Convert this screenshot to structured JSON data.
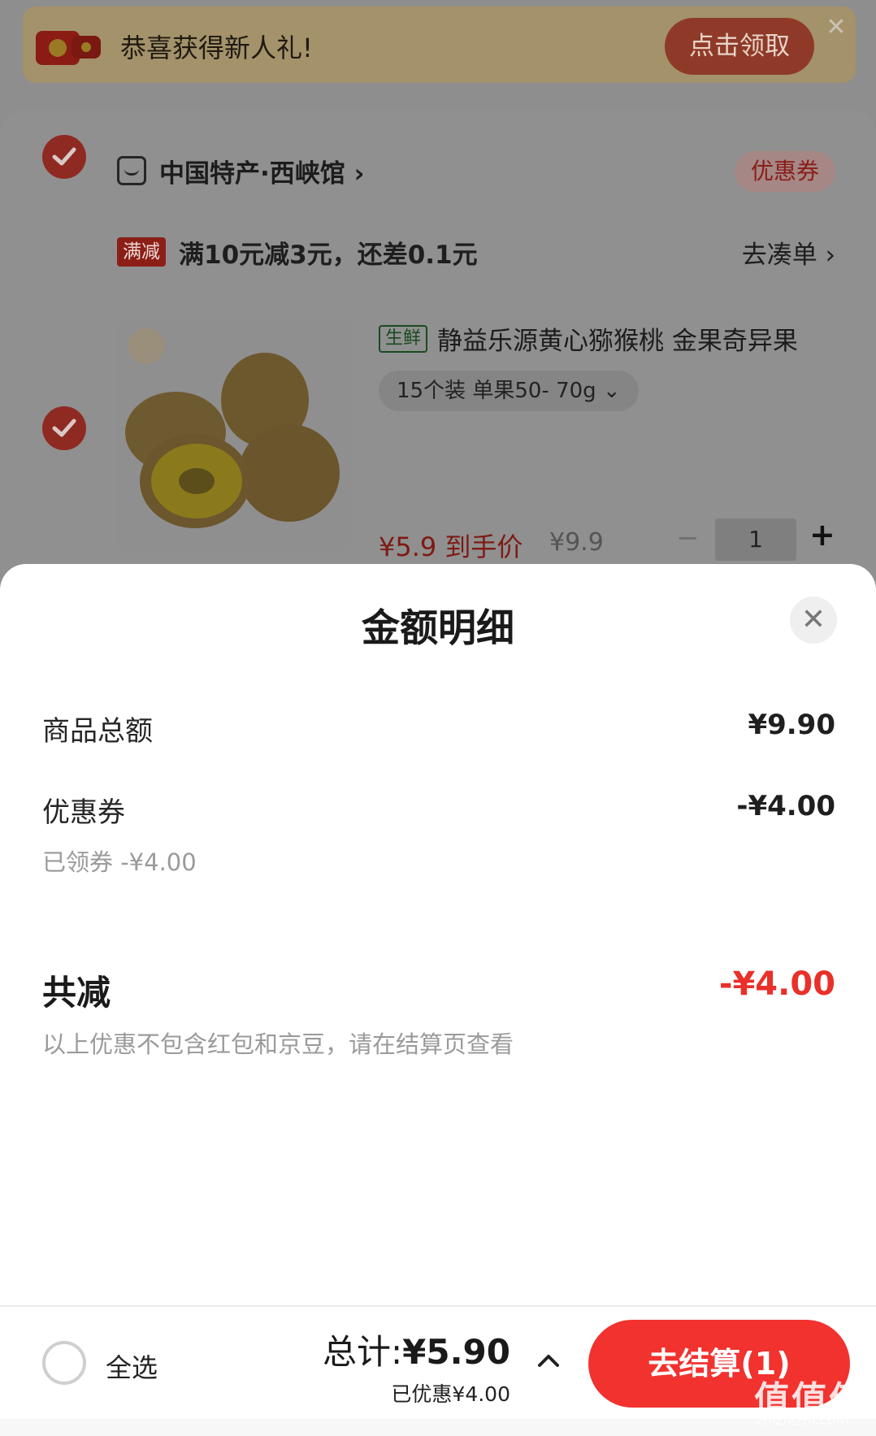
{
  "promo": {
    "text": "恭喜获得新人礼!",
    "button": "点击领取",
    "close": "✕"
  },
  "store": {
    "name": "中国特产·西峡馆",
    "arrow": "›",
    "coupon": "优惠券",
    "promo_tag": "满减",
    "promo_rule": "满10元减3元，还差0.1元",
    "go_order": "去凑单 ›"
  },
  "product": {
    "tag": "生鲜",
    "title": "静益乐源黄心猕猴桃 金果奇异果",
    "spec": "15个装 单果50- 70g ⌄",
    "price_now": "¥5.9 到手价",
    "price_orig": "¥9.9",
    "qty": "1",
    "minus": "−",
    "plus": "+"
  },
  "sheet": {
    "title": "金额明细",
    "close": "✕",
    "goods_total_label": "商品总额",
    "goods_total_value": "¥9.90",
    "coupon_label": "优惠券",
    "coupon_value": "-¥4.00",
    "coupon_sub": "已领券 -¥4.00",
    "total_label": "共减",
    "total_value": "-¥4.00",
    "note": "以上优惠不包含红包和京豆，请在结算页查看"
  },
  "action_bar": {
    "select_all": "全选",
    "total_prefix": "总计:",
    "total_value": "¥5.90",
    "saved": "已优惠¥4.00",
    "checkout": "去结算(1)"
  },
  "watermark": {
    "main": "值值值",
    "sub": "zhizhizhi.com"
  },
  "colors": {
    "accent": "#f1322f",
    "discount": "#e9302a"
  }
}
